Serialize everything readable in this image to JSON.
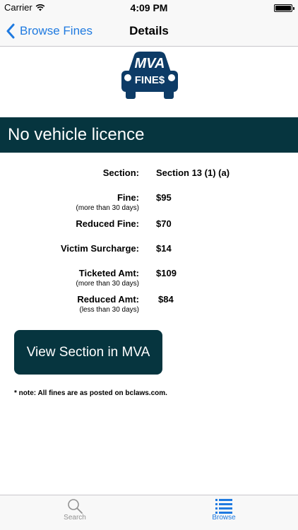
{
  "status_bar": {
    "carrier": "Carrier",
    "time": "4:09 PM"
  },
  "nav": {
    "back_label": "Browse Fines",
    "title": "Details"
  },
  "logo": {
    "text_top": "MVA",
    "text_bottom": "FINE$"
  },
  "title": "No vehicle licence",
  "details": {
    "section": {
      "label": "Section:",
      "value": "Section 13 (1) (a)"
    },
    "fine": {
      "label": "Fine:",
      "note": "(more than 30 days)",
      "value": "$95"
    },
    "reduced_fine": {
      "label": "Reduced Fine:",
      "value": "$70"
    },
    "victim_surcharge": {
      "label": "Victim Surcharge:",
      "value": "$14"
    },
    "ticketed_amt": {
      "label": "Ticketed Amt:",
      "note": "(more than 30 days)",
      "value": "$109"
    },
    "reduced_amt": {
      "label": "Reduced Amt:",
      "note": "(less than 30 days)",
      "value": "$84"
    }
  },
  "button_label": "View Section in MVA",
  "footnote": "* note: All fines are as posted on bclaws.com.",
  "tabs": [
    {
      "label": "Search",
      "icon": "search-icon",
      "active": false
    },
    {
      "label": "Browse",
      "icon": "list-icon",
      "active": true
    }
  ],
  "colors": {
    "accent": "#1f7ae0",
    "brand_dark": "#06353f",
    "logo_blue": "#0d3b66",
    "tab_inactive": "#929292",
    "bar_background": "#f8f8f8"
  }
}
